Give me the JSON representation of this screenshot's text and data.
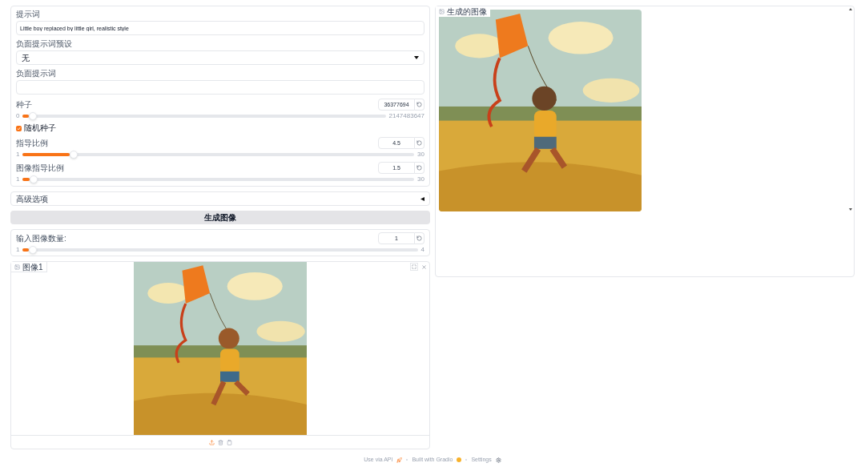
{
  "prompt": {
    "label": "提示词",
    "value": "Little boy replaced by little girl, realistic style"
  },
  "negative_preset": {
    "label": "负面提示词预设",
    "value": "无"
  },
  "negative_prompt": {
    "label": "负面提示词"
  },
  "seed": {
    "label": "种子",
    "value": "36377694",
    "min": "0",
    "max": "2147483647",
    "level": 0.017
  },
  "random_seed": {
    "label": "随机种子",
    "checked": true
  },
  "sliders": [
    {
      "label": "指导比例",
      "value": "4.5",
      "min": "1",
      "max": "30",
      "level": 0.12
    },
    {
      "label": "图像指导比例",
      "value": "1.5",
      "min": "1",
      "max": "30",
      "level": 0.017
    }
  ],
  "advanced": {
    "label": "高级选项",
    "expanded": false
  },
  "generate_button": "生成图像",
  "image_count": {
    "label": "输入图像数量:",
    "value": "1",
    "min": "1",
    "max": "4",
    "level": 0
  },
  "input_image": {
    "label": "图像1"
  },
  "output_image": {
    "label": "生成的图像"
  },
  "footer": [
    "Use via API",
    "Built with Gradio",
    "Settings"
  ]
}
